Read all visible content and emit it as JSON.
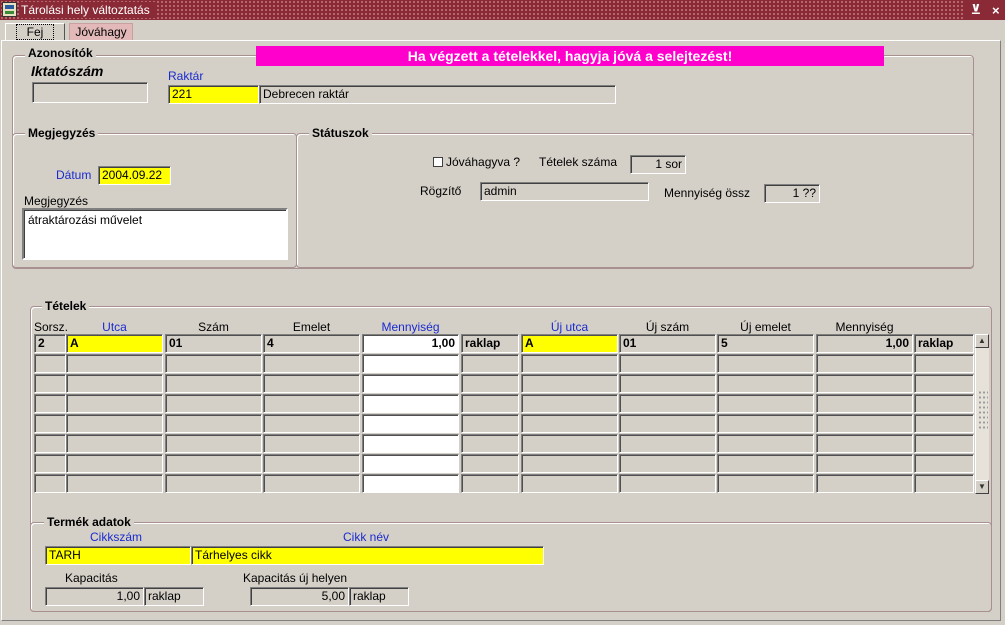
{
  "window": {
    "title": "Tárolási hely változtatás",
    "controls": [
      "⊻",
      "×"
    ]
  },
  "tabs": [
    {
      "label": "Fej"
    },
    {
      "label": "Jóváhagy"
    }
  ],
  "banner": "Ha végzett a tételekkel, hagyja jóvá a selejtezést!",
  "azonositok": {
    "legend": "Azonosítók",
    "iktatoszam_label": "Iktatószám",
    "iktatoszam_value": "",
    "raktar_label": "Raktár",
    "raktar_code": "221",
    "raktar_name": "Debrecen raktár"
  },
  "megjegyzes_frame": {
    "legend": "Megjegyzés",
    "datum_label": "Dátum",
    "datum_value": "2004.09.22",
    "megjegyzes_label": "Megjegyzés",
    "megjegyzes_value": "átraktározási művelet"
  },
  "statuszok": {
    "legend": "Státuszok",
    "jovahagyva_label": "Jóváhagyva ?",
    "jovahagyva_checked": false,
    "tetelek_szama_label": "Tételek száma",
    "tetelek_szama_value": "1 sor",
    "rogzito_label": "Rögzítő",
    "rogzito_value": "admin",
    "mennyiseg_ossz_label": "Mennyiség össz",
    "mennyiseg_ossz_value": "1 ??"
  },
  "tetelek": {
    "legend": "Tételek",
    "headers": {
      "sorsz": "Sorsz.",
      "utca": "Utca",
      "szam": "Szám",
      "emelet": "Emelet",
      "mennyiseg": "Mennyiség",
      "uj_utca": "Új utca",
      "uj_szam": "Új szám",
      "uj_emelet": "Új emelet",
      "mennyiseg2": "Mennyiség"
    },
    "rows": [
      {
        "sorsz": "2",
        "utca": "A",
        "szam": "01",
        "emelet": "4",
        "mennyiseg": "1,00",
        "egyseg": "raklap",
        "uj_utca": "A",
        "uj_szam": "01",
        "uj_emelet": "5",
        "mennyiseg2": "1,00",
        "egyseg2": "raklap"
      }
    ]
  },
  "termek": {
    "legend": "Termék adatok",
    "cikkszam_label": "Cikkszám",
    "cikkszam_value": "TARH",
    "cikknev_label": "Cikk név",
    "cikknev_value": "Tárhelyes cikk",
    "kapacitas_label": "Kapacitás",
    "kapacitas_value": "1,00",
    "kapacitas_unit": "raklap",
    "kapacitas_uj_label": "Kapacitás új helyen",
    "kapacitas_uj_value": "5,00",
    "kapacitas_uj_unit": "raklap"
  },
  "colors": {
    "title_bar": "#8a2a36",
    "banner": "#ff00cc",
    "required_field": "#ffff00",
    "label_blue": "#1a2ad0"
  }
}
